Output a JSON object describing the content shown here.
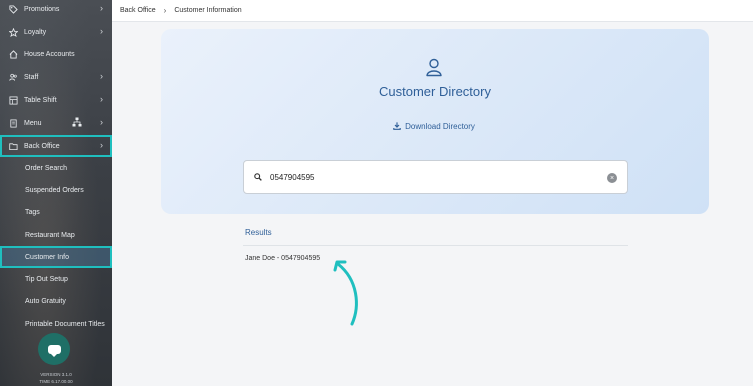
{
  "sidebar": {
    "items": [
      {
        "label": "Promotions",
        "icon": "tag-icon"
      },
      {
        "label": "Loyalty",
        "icon": "star-icon"
      },
      {
        "label": "House Accounts",
        "icon": "house-icon"
      },
      {
        "label": "Staff",
        "icon": "users-icon"
      },
      {
        "label": "Table Shift",
        "icon": "table-icon"
      },
      {
        "label": "Menu",
        "icon": "menu-icon"
      },
      {
        "label": "Back Office",
        "icon": "folder-icon"
      }
    ],
    "sub_items": [
      "Order Search",
      "Suspended Orders",
      "Tags",
      "Restaurant Map",
      "Customer Info",
      "Tip Out Setup",
      "Auto Gratuity",
      "Printable Document Titles"
    ],
    "version_lines": [
      "VERSION 3.1.0",
      "TIME 6.17.00.00"
    ]
  },
  "breadcrumb": {
    "root": "Back Office",
    "current": "Customer Information"
  },
  "card": {
    "title": "Customer Directory",
    "download_label": "Download Directory"
  },
  "search": {
    "value": "0547904595"
  },
  "results": {
    "label": "Results",
    "items": [
      "Jane Doe - 0547904595"
    ]
  },
  "colors": {
    "highlight": "#1fbfbf",
    "accent": "#2f5f98"
  }
}
